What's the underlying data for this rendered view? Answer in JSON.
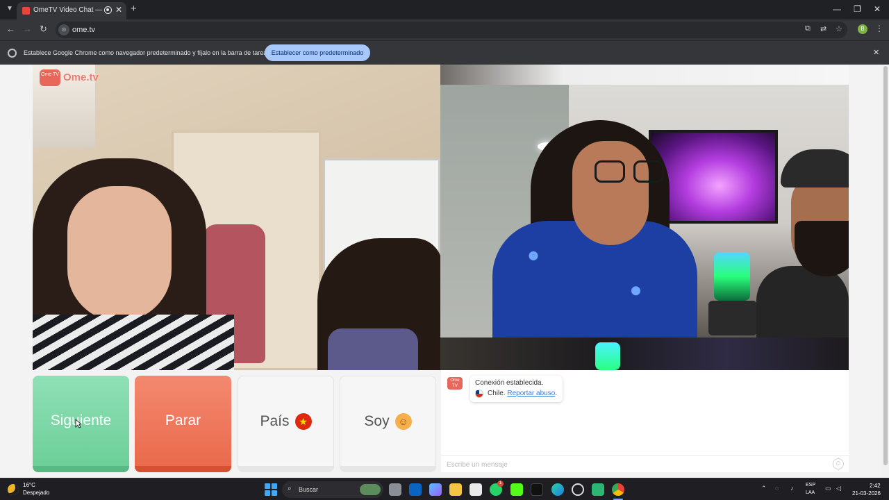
{
  "browser": {
    "tab_title": "OmeTV Video Chat — Omegle",
    "new_tab_icon": "plus-icon",
    "url": "ome.tv",
    "infobar_text": "Establece Google Chrome como navegador predeterminado y fíjalo en la barra de tareas",
    "infobar_button": "Establecer como predeterminado",
    "profile_initial": "B"
  },
  "video": {
    "logo_box": "Ome TV",
    "logo_text": "Ome.tv"
  },
  "controls": {
    "next_label": "Siguiente",
    "stop_label": "Parar",
    "country_label": "País",
    "country_flag": "CN",
    "gender_label": "Soy",
    "gender_icon": "boy-face-icon"
  },
  "chat": {
    "logo": "Ome TV",
    "status_line": "Conexión establecida.",
    "country": "Chile.",
    "report_link": "Reportar abuso",
    "report_suffix": ".",
    "placeholder": "Escribe un mensaje"
  },
  "taskbar": {
    "weather_temp": "16°C",
    "weather_desc": "Despejado",
    "search_label": "Buscar",
    "lang_line1": "ESP",
    "lang_line2": "LAA",
    "time": "2:42",
    "date": "21-03-2026",
    "notification_count": "1"
  },
  "colors": {
    "next_green": "#6dcf98",
    "stop_red": "#ea6a4d",
    "infobar_button_blue": "#a8c7fa"
  }
}
